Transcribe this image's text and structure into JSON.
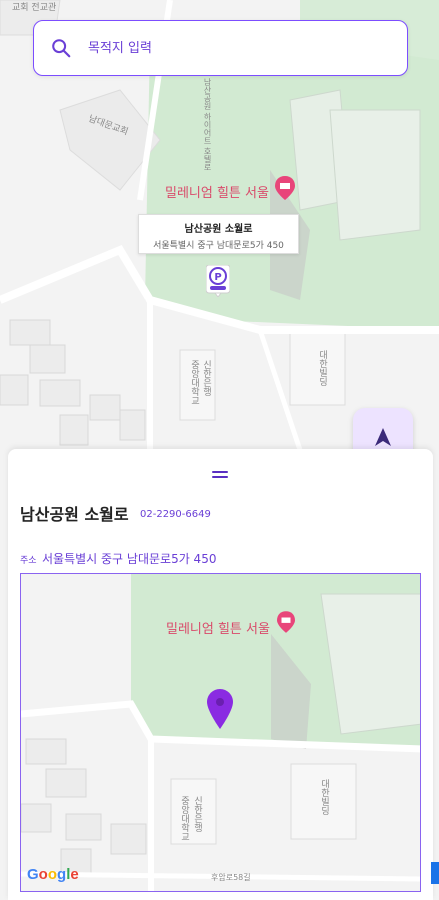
{
  "search": {
    "placeholder": "목적지 입력"
  },
  "map": {
    "labels": {
      "top_left": "교회\n전교관",
      "church": "남대문교회",
      "hotel": "밀레니엄 힐튼 서울",
      "vertical_road": "남산공원 하이어트 호텔로",
      "building_a": "중앙대학교",
      "building_b": "신한은행",
      "building_c": "대한빌딩"
    },
    "callout": {
      "title": "남산공원 소월로",
      "address": "서울특별시 중구 남대문로5가 450"
    }
  },
  "sheet": {
    "place_name": "남산공원 소월로",
    "phone": "02-2290-6649",
    "address_label": "주소",
    "address": "서울특별시 중구 남대문로5가 450"
  },
  "mini_map": {
    "hotel_label": "밀레니엄 힐튼 서울",
    "road_label": "후암로58길",
    "building_a": "중앙대학교",
    "building_b": "신한은행",
    "building_c": "대한빌딩",
    "google": [
      "G",
      "o",
      "o",
      "g",
      "l",
      "e"
    ]
  },
  "colors": {
    "accent": "#7c4dff",
    "accent_text": "#6a3fd6",
    "park_green": "#cfe8cf",
    "hotel_pink": "#e8457a",
    "marker_purple": "#8a2be2"
  }
}
